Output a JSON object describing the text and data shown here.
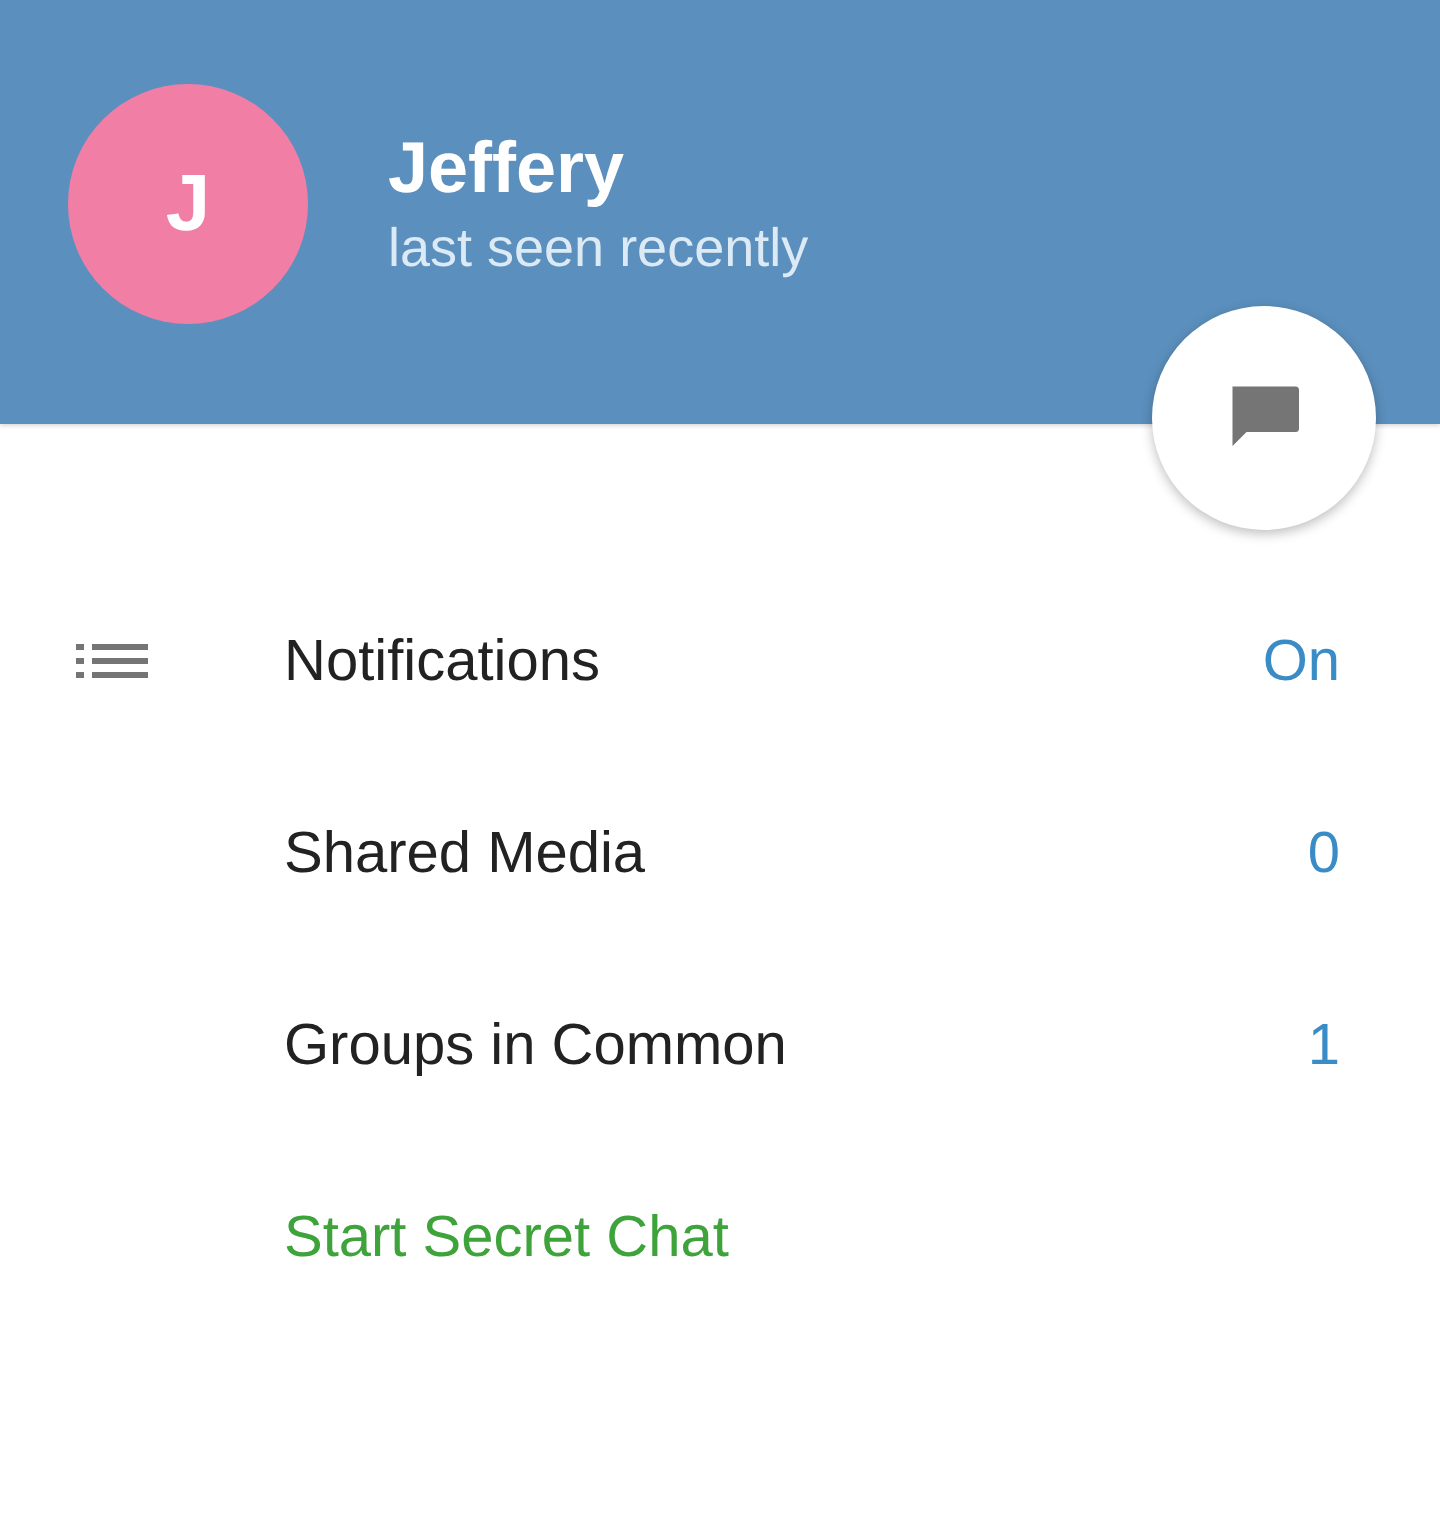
{
  "header": {
    "avatar_letter": "J",
    "name": "Jeffery",
    "status": "last seen recently"
  },
  "rows": [
    {
      "kind": "setting",
      "label": "Notifications",
      "value": "On",
      "icon": true
    },
    {
      "kind": "setting",
      "label": "Shared Media",
      "value": "0",
      "icon": false
    },
    {
      "kind": "setting",
      "label": "Groups in Common",
      "value": "1",
      "icon": false
    },
    {
      "kind": "action",
      "label": "Start Secret Chat",
      "icon": false
    }
  ]
}
